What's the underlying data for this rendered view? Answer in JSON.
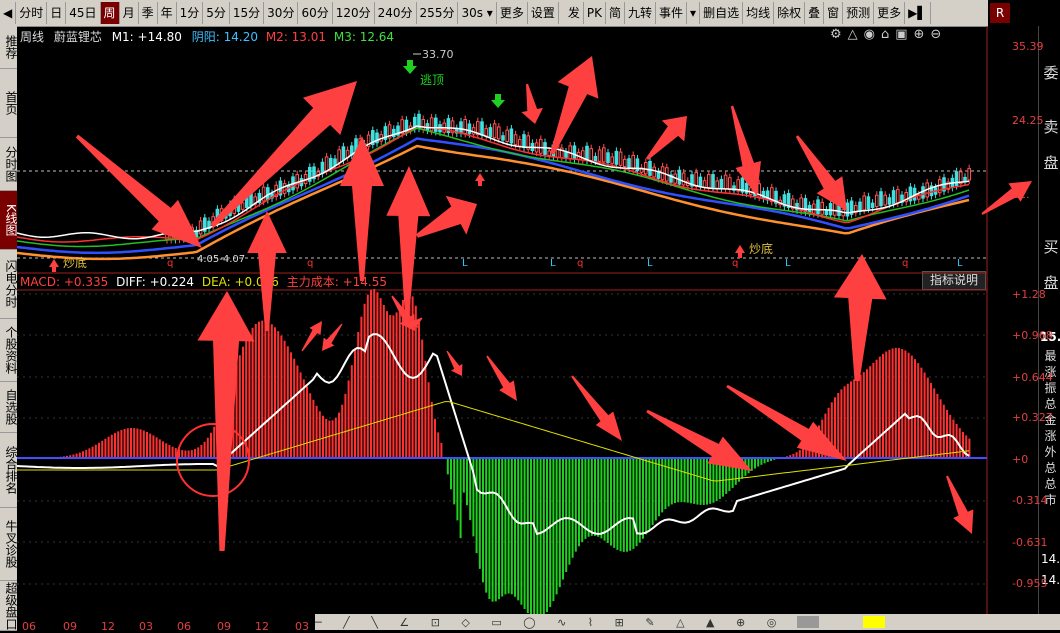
{
  "toolbar": {
    "items": [
      "分时",
      "日",
      "45日",
      "周",
      "月",
      "季",
      "年",
      "1分",
      "5分",
      "15分",
      "30分",
      "60分",
      "120分",
      "240分",
      "255分",
      "30s",
      "更多",
      "设置"
    ],
    "active_index": 3,
    "right_items": [
      "发",
      "PK",
      "简",
      "九转",
      "事件",
      "▾",
      "删自选",
      "均线",
      "除权",
      "叠",
      "窗",
      "预测",
      "更多"
    ],
    "r_label": "R"
  },
  "leftnav": [
    "推荐",
    "首页",
    "分时图",
    "K线图",
    "闪电分时",
    "个股资料",
    "自选股",
    "综合排名",
    "牛叉诊股",
    "超级盘口"
  ],
  "leftnav_active": 3,
  "rightpanel": {
    "big": [
      "委",
      "卖",
      "盘",
      "买",
      "盘"
    ],
    "small": [
      "最",
      "涨",
      "振",
      "总",
      "金",
      "涨",
      "外",
      "总",
      "总",
      "市"
    ],
    "value": "15."
  },
  "kline": {
    "period": "周线",
    "name": "蔚蓝锂芯",
    "m1": "M1: +14.80",
    "yinyang": "阴阳: 14.20",
    "m2": "M2: 13.01",
    "m3": "M3: 12.64",
    "high": "33.70",
    "escape_label": "逃顶",
    "bottom_label_1": "炒底",
    "bottom_label_2": "炒底",
    "date_range": "4.05-4.07",
    "axis": [
      "35.39",
      "24.25",
      "12."
    ],
    "signals": [
      "q",
      "q",
      "L",
      "L",
      "q",
      "L",
      "q",
      "L",
      "q",
      "L"
    ]
  },
  "macd": {
    "macd": "MACD: +0.335",
    "diff": "DIFF: +0.224",
    "dea": "DEA: +0.056",
    "cost": "主力成本: +14.55",
    "indicator_btn": "指标说明",
    "axis": [
      "+1.28",
      "+0.968",
      "+0.644",
      "+0.327",
      "+0",
      "-0.314",
      "-0.631",
      "-0.955"
    ]
  },
  "xaxis": [
    "06",
    "09",
    "12",
    "03",
    "06",
    "09",
    "12",
    "03"
  ],
  "right_values": [
    "14.",
    "14."
  ],
  "colors": {
    "up": "#ff3030",
    "down": "#20d020",
    "diff": "#ffffff",
    "dea": "#e0e000",
    "ma_blue": "#3050ff",
    "ma_orange": "#ff9030",
    "arrow": "#ff4040"
  }
}
